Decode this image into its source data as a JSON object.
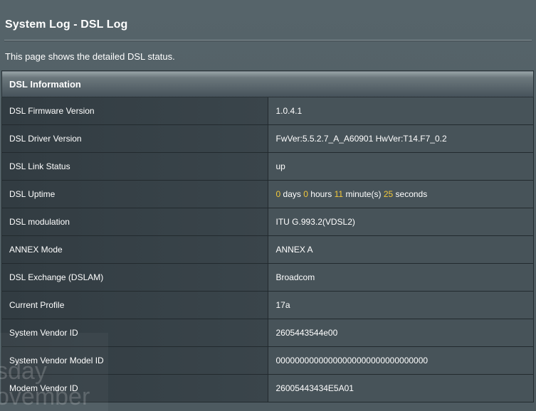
{
  "page": {
    "title": "System Log - DSL Log",
    "description": "This page shows the detailed DSL status."
  },
  "table": {
    "header": "DSL Information",
    "rows": [
      {
        "label": "DSL Firmware Version",
        "value": "1.0.4.1"
      },
      {
        "label": "DSL Driver Version",
        "value": "FwVer:5.5.2.7_A_A60901 HwVer:T14.F7_0.2"
      },
      {
        "label": "DSL Link Status",
        "value": "up"
      },
      {
        "label": "DSL Uptime",
        "uptime": {
          "days": "0",
          "days_label": "days",
          "hours": "0",
          "hours_label": "hours",
          "minutes": "11",
          "minutes_label": "minute(s)",
          "seconds": "25",
          "seconds_label": "seconds"
        }
      },
      {
        "label": "DSL modulation",
        "value": "ITU G.993.2(VDSL2)"
      },
      {
        "label": "ANNEX Mode",
        "value": "ANNEX A"
      },
      {
        "label": "DSL Exchange (DSLAM)",
        "value": "Broadcom"
      },
      {
        "label": "Current Profile",
        "value": "17a"
      },
      {
        "label": "System Vendor ID",
        "value": "2605443544e00"
      },
      {
        "label": "System Vendor Model ID",
        "value": "00000000000000000000000000000000"
      },
      {
        "label": "Modem Vendor ID",
        "value": "26005443434E5A01"
      }
    ]
  },
  "watermark": {
    "line1": "sday",
    "line2": "ovember"
  },
  "colors": {
    "highlight": "#f2c83a",
    "background": "#56646a"
  }
}
